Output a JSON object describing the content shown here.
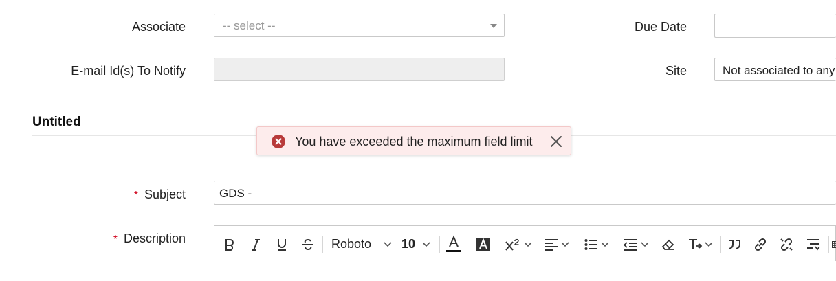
{
  "form": {
    "associate": {
      "label": "Associate",
      "placeholder": "-- select --"
    },
    "email": {
      "label": "E-mail Id(s) To Notify",
      "value": ""
    },
    "due_date": {
      "label": "Due Date",
      "value": ""
    },
    "site": {
      "label": "Site",
      "value": "Not associated to any"
    }
  },
  "section": {
    "title": "Untitled"
  },
  "toast": {
    "message": "You have exceeded the maximum field limit",
    "icon": "error-icon",
    "color": "#b83a3a"
  },
  "subject": {
    "label": "Subject",
    "required_mark": "*",
    "value": "GDS -"
  },
  "description": {
    "label": "Description",
    "required_mark": "*"
  },
  "toolbar": {
    "font_family": "Roboto",
    "font_size": "10",
    "buttons": [
      "bold",
      "italic",
      "underline",
      "strikethrough",
      "font-family",
      "font-size",
      "text-color",
      "background-color",
      "superscript",
      "align",
      "bulleted-list",
      "indent",
      "clear-format",
      "text-direction",
      "blockquote",
      "insert-link",
      "remove-link",
      "line-height",
      "table"
    ]
  }
}
